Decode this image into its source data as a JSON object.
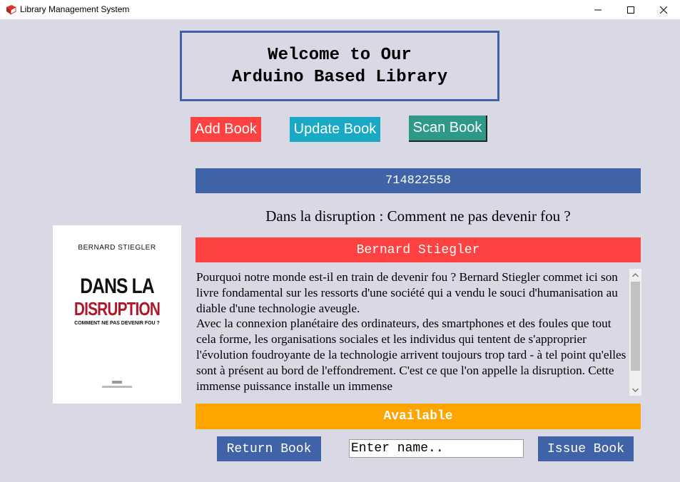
{
  "window": {
    "title": "Library Management System",
    "icon": "book-icon"
  },
  "header": {
    "line1": "Welcome to Our",
    "line2": "Arduino Based Library"
  },
  "toolbar": {
    "add_label": "Add Book",
    "update_label": "Update Book",
    "scan_label": "Scan Book"
  },
  "book": {
    "isbn": "714822558",
    "title": "Dans la disruption : Comment ne pas devenir fou ?",
    "author": "Bernard Stiegler",
    "description": "Pourquoi notre monde est-il en train de devenir fou ? Bernard Stiegler commet ici son livre fondamental sur les ressorts d'une société qui a vendu le souci d'humanisation au diable d'une technologie aveugle.\nAvec la connexion planétaire des ordinateurs, des smartphones et des foules que tout cela forme, les organisations sociales et les individus qui tentent de s'approprier l'évolution foudroyante de la technologie arrivent toujours trop tard - à tel point qu'elles sont à présent au bord de l'effondrement. C'est ce que l'on appelle la disruption. Cette immense puissance installe un immense",
    "status": "Available",
    "cover": {
      "author": "BERNARD STIEGLER",
      "title_line1": "DANS LA",
      "title_line2": "DISRUPTION",
      "subtitle": "COMMENT NE PAS DEVENIR FOU ?"
    }
  },
  "actions": {
    "return_label": "Return Book",
    "issue_label": "Issue Book",
    "name_placeholder": "Enter name.."
  },
  "colors": {
    "background": "#d9d9e6",
    "blue": "#3f63a6",
    "red": "#fe4141",
    "teal": "#19a9c4",
    "green": "#2e9989",
    "orange": "#fea500"
  }
}
